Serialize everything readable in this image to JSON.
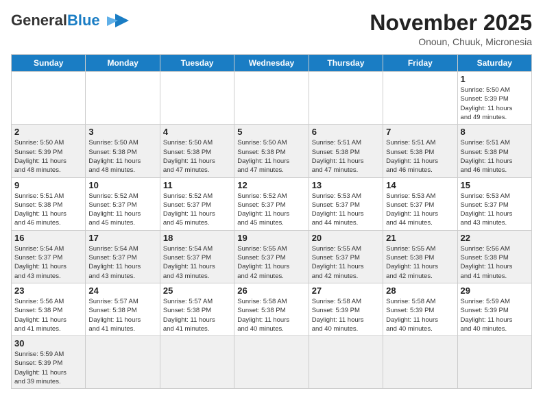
{
  "header": {
    "logo_general": "General",
    "logo_blue": "Blue",
    "month_title": "November 2025",
    "location": "Onoun, Chuuk, Micronesia"
  },
  "weekdays": [
    "Sunday",
    "Monday",
    "Tuesday",
    "Wednesday",
    "Thursday",
    "Friday",
    "Saturday"
  ],
  "weeks": [
    [
      {
        "day": null,
        "info": null
      },
      {
        "day": null,
        "info": null
      },
      {
        "day": null,
        "info": null
      },
      {
        "day": null,
        "info": null
      },
      {
        "day": null,
        "info": null
      },
      {
        "day": null,
        "info": null
      },
      {
        "day": "1",
        "info": "Sunrise: 5:50 AM\nSunset: 5:39 PM\nDaylight: 11 hours\nand 49 minutes."
      }
    ],
    [
      {
        "day": "2",
        "info": "Sunrise: 5:50 AM\nSunset: 5:39 PM\nDaylight: 11 hours\nand 48 minutes."
      },
      {
        "day": "3",
        "info": "Sunrise: 5:50 AM\nSunset: 5:38 PM\nDaylight: 11 hours\nand 48 minutes."
      },
      {
        "day": "4",
        "info": "Sunrise: 5:50 AM\nSunset: 5:38 PM\nDaylight: 11 hours\nand 47 minutes."
      },
      {
        "day": "5",
        "info": "Sunrise: 5:50 AM\nSunset: 5:38 PM\nDaylight: 11 hours\nand 47 minutes."
      },
      {
        "day": "6",
        "info": "Sunrise: 5:51 AM\nSunset: 5:38 PM\nDaylight: 11 hours\nand 47 minutes."
      },
      {
        "day": "7",
        "info": "Sunrise: 5:51 AM\nSunset: 5:38 PM\nDaylight: 11 hours\nand 46 minutes."
      },
      {
        "day": "8",
        "info": "Sunrise: 5:51 AM\nSunset: 5:38 PM\nDaylight: 11 hours\nand 46 minutes."
      }
    ],
    [
      {
        "day": "9",
        "info": "Sunrise: 5:51 AM\nSunset: 5:38 PM\nDaylight: 11 hours\nand 46 minutes."
      },
      {
        "day": "10",
        "info": "Sunrise: 5:52 AM\nSunset: 5:37 PM\nDaylight: 11 hours\nand 45 minutes."
      },
      {
        "day": "11",
        "info": "Sunrise: 5:52 AM\nSunset: 5:37 PM\nDaylight: 11 hours\nand 45 minutes."
      },
      {
        "day": "12",
        "info": "Sunrise: 5:52 AM\nSunset: 5:37 PM\nDaylight: 11 hours\nand 45 minutes."
      },
      {
        "day": "13",
        "info": "Sunrise: 5:53 AM\nSunset: 5:37 PM\nDaylight: 11 hours\nand 44 minutes."
      },
      {
        "day": "14",
        "info": "Sunrise: 5:53 AM\nSunset: 5:37 PM\nDaylight: 11 hours\nand 44 minutes."
      },
      {
        "day": "15",
        "info": "Sunrise: 5:53 AM\nSunset: 5:37 PM\nDaylight: 11 hours\nand 43 minutes."
      }
    ],
    [
      {
        "day": "16",
        "info": "Sunrise: 5:54 AM\nSunset: 5:37 PM\nDaylight: 11 hours\nand 43 minutes."
      },
      {
        "day": "17",
        "info": "Sunrise: 5:54 AM\nSunset: 5:37 PM\nDaylight: 11 hours\nand 43 minutes."
      },
      {
        "day": "18",
        "info": "Sunrise: 5:54 AM\nSunset: 5:37 PM\nDaylight: 11 hours\nand 43 minutes."
      },
      {
        "day": "19",
        "info": "Sunrise: 5:55 AM\nSunset: 5:37 PM\nDaylight: 11 hours\nand 42 minutes."
      },
      {
        "day": "20",
        "info": "Sunrise: 5:55 AM\nSunset: 5:37 PM\nDaylight: 11 hours\nand 42 minutes."
      },
      {
        "day": "21",
        "info": "Sunrise: 5:55 AM\nSunset: 5:38 PM\nDaylight: 11 hours\nand 42 minutes."
      },
      {
        "day": "22",
        "info": "Sunrise: 5:56 AM\nSunset: 5:38 PM\nDaylight: 11 hours\nand 41 minutes."
      }
    ],
    [
      {
        "day": "23",
        "info": "Sunrise: 5:56 AM\nSunset: 5:38 PM\nDaylight: 11 hours\nand 41 minutes."
      },
      {
        "day": "24",
        "info": "Sunrise: 5:57 AM\nSunset: 5:38 PM\nDaylight: 11 hours\nand 41 minutes."
      },
      {
        "day": "25",
        "info": "Sunrise: 5:57 AM\nSunset: 5:38 PM\nDaylight: 11 hours\nand 41 minutes."
      },
      {
        "day": "26",
        "info": "Sunrise: 5:58 AM\nSunset: 5:38 PM\nDaylight: 11 hours\nand 40 minutes."
      },
      {
        "day": "27",
        "info": "Sunrise: 5:58 AM\nSunset: 5:39 PM\nDaylight: 11 hours\nand 40 minutes."
      },
      {
        "day": "28",
        "info": "Sunrise: 5:58 AM\nSunset: 5:39 PM\nDaylight: 11 hours\nand 40 minutes."
      },
      {
        "day": "29",
        "info": "Sunrise: 5:59 AM\nSunset: 5:39 PM\nDaylight: 11 hours\nand 40 minutes."
      }
    ],
    [
      {
        "day": "30",
        "info": "Sunrise: 5:59 AM\nSunset: 5:39 PM\nDaylight: 11 hours\nand 39 minutes."
      },
      {
        "day": null,
        "info": null
      },
      {
        "day": null,
        "info": null
      },
      {
        "day": null,
        "info": null
      },
      {
        "day": null,
        "info": null
      },
      {
        "day": null,
        "info": null
      },
      {
        "day": null,
        "info": null
      }
    ]
  ]
}
